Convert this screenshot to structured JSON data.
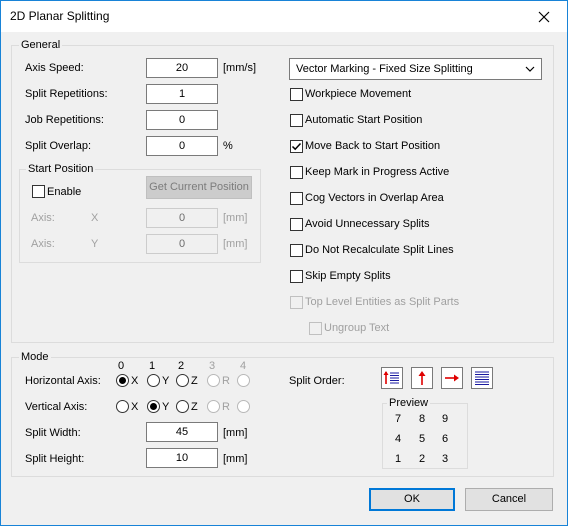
{
  "window": {
    "title": "2D Planar Splitting"
  },
  "general": {
    "group_label": "General",
    "axis_speed": {
      "label": "Axis Speed:",
      "value": "20",
      "unit": "[mm/s]"
    },
    "split_repetitions": {
      "label": "Split Repetitions:",
      "value": "1"
    },
    "job_repetitions": {
      "label": "Job Repetitions:",
      "value": "0"
    },
    "split_overlap": {
      "label": "Split Overlap:",
      "value": "0",
      "unit": "%"
    },
    "mode_select": {
      "value": "Vector Marking - Fixed Size Splitting"
    },
    "start_position": {
      "group_label": "Start Position",
      "enable_label": "Enable",
      "get_current_label": "Get Current Position",
      "axis_x": {
        "label": "Axis:",
        "axis": "X",
        "value": "0",
        "unit": "[mm]"
      },
      "axis_y": {
        "label": "Axis:",
        "axis": "Y",
        "value": "0",
        "unit": "[mm]"
      }
    },
    "options": [
      {
        "label": "Workpiece Movement",
        "checked": false,
        "enabled": true
      },
      {
        "label": "Automatic Start Position",
        "checked": false,
        "enabled": true
      },
      {
        "label": "Move Back to Start Position",
        "checked": true,
        "enabled": true
      },
      {
        "label": "Keep Mark in Progress Active",
        "checked": false,
        "enabled": true
      },
      {
        "label": "Cog Vectors in Overlap Area",
        "checked": false,
        "enabled": true
      },
      {
        "label": "Avoid Unnecessary Splits",
        "checked": false,
        "enabled": true
      },
      {
        "label": "Do Not Recalculate Split Lines",
        "checked": false,
        "enabled": true
      },
      {
        "label": "Skip Empty Splits",
        "checked": false,
        "enabled": true
      },
      {
        "label": "Top Level Entities as Split Parts",
        "checked": false,
        "enabled": false
      },
      {
        "label": "Ungroup Text",
        "checked": false,
        "enabled": false
      }
    ]
  },
  "mode": {
    "group_label": "Mode",
    "indices": [
      "0",
      "1",
      "2",
      "3",
      "4"
    ],
    "horizontal_axis": {
      "label": "Horizontal Axis:",
      "selected": "X"
    },
    "vertical_axis": {
      "label": "Vertical Axis:",
      "selected": "Y"
    },
    "radio_letters": [
      "X",
      "Y",
      "Z",
      "R",
      ""
    ],
    "split_width": {
      "label": "Split Width:",
      "value": "45",
      "unit": "[mm]"
    },
    "split_height": {
      "label": "Split Height:",
      "value": "10",
      "unit": "[mm]"
    },
    "split_order_label": "Split Order:",
    "split_order_icons": [
      "lines-up-arrow-icon",
      "up-arrow-icon",
      "right-arrow-icon",
      "lines-icon"
    ],
    "preview": {
      "label": "Preview",
      "grid": [
        [
          "7",
          "8",
          "9"
        ],
        [
          "4",
          "5",
          "6"
        ],
        [
          "1",
          "2",
          "3"
        ]
      ]
    }
  },
  "buttons": {
    "ok": "OK",
    "cancel": "Cancel"
  },
  "colors": {
    "accent": "#0078d7",
    "arrow_red": "#e00000",
    "line_blue": "#1a1aa0"
  }
}
